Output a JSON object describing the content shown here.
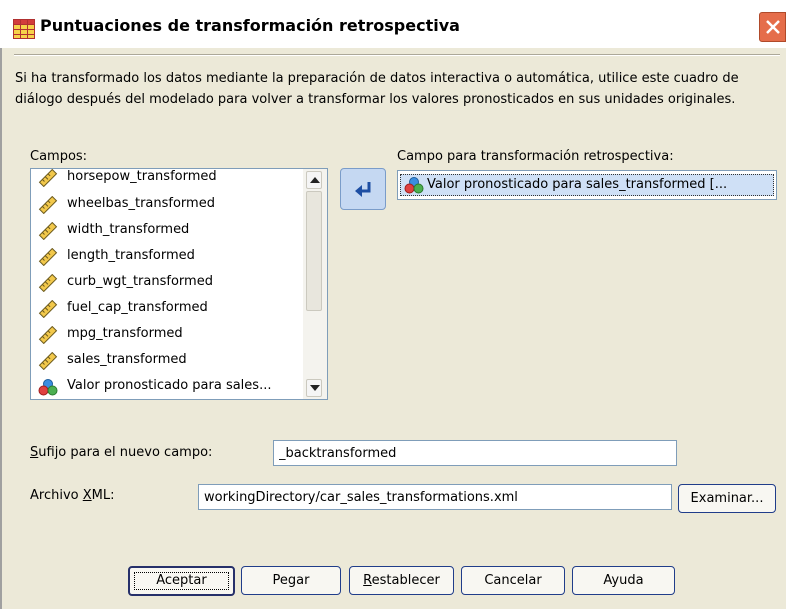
{
  "window": {
    "title": "Puntuaciones de transformación retrospectiva"
  },
  "description": "Si ha transformado los datos mediante la preparación de datos interactiva o automática, utilice este cuadro de diálogo después del modelado para volver a transformar los valores pronosticados en sus unidades originales.",
  "fields": {
    "label": "Campos:",
    "items": [
      {
        "label": "horsepow_transformed",
        "icon": "ruler-icon"
      },
      {
        "label": "wheelbas_transformed",
        "icon": "ruler-icon"
      },
      {
        "label": "width_transformed",
        "icon": "ruler-icon"
      },
      {
        "label": "length_transformed",
        "icon": "ruler-icon"
      },
      {
        "label": "curb_wgt_transformed",
        "icon": "ruler-icon"
      },
      {
        "label": "fuel_cap_transformed",
        "icon": "ruler-icon"
      },
      {
        "label": "mpg_transformed",
        "icon": "ruler-icon"
      },
      {
        "label": "sales_transformed",
        "icon": "ruler-icon"
      },
      {
        "label": "Valor pronosticado para sales...",
        "icon": "nominal-balls-icon"
      }
    ]
  },
  "target": {
    "label": "Campo para transformación retrospectiva:",
    "value": "Valor pronosticado para sales_transformed [..."
  },
  "suffix": {
    "label_mnemonic": "S",
    "label_rest": "ufijo para el nuevo campo:",
    "value": "_backtransformed"
  },
  "xml": {
    "label_before": "Archivo ",
    "label_mnemonic": "X",
    "label_after": "ML:",
    "value": "workingDirectory/car_sales_transformations.xml",
    "browse_label": "Examinar..."
  },
  "buttons": {
    "ok": "Aceptar",
    "paste": "Pegar",
    "reset_mnemonic": "R",
    "reset_rest": "establecer",
    "cancel": "Cancelar",
    "help": "Ayuda"
  },
  "colors": {
    "dialog_bg": "#ece9d8",
    "close_button": "#e56d4a",
    "selection": "#cfe0f6",
    "move_button": "#c5d8f2"
  }
}
